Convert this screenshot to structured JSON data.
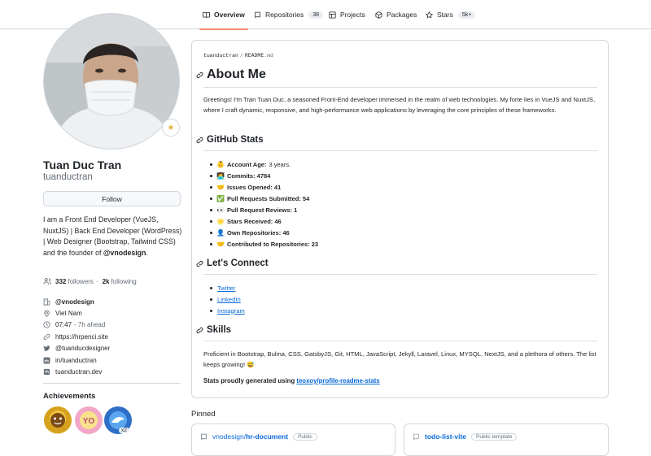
{
  "nav": {
    "tabs": [
      {
        "label": "Overview",
        "icon": "book-icon",
        "active": true
      },
      {
        "label": "Repositories",
        "icon": "repo-icon",
        "count": "38"
      },
      {
        "label": "Projects",
        "icon": "table-icon"
      },
      {
        "label": "Packages",
        "icon": "package-icon"
      },
      {
        "label": "Stars",
        "icon": "star-icon",
        "count": "5k+"
      }
    ]
  },
  "profile": {
    "full_name": "Tuan Duc Tran",
    "login": "tuanductran",
    "follow_label": "Follow",
    "bio_text": "I am a Front End Developer (VueJS, NuxtJS) | Back End Developer (WordPress) | Web Designer (Bootstrap, Tailwind CSS) and the founder of ",
    "bio_org": "@vnodesign",
    "bio_end": ".",
    "followers": "332",
    "followers_label": "followers",
    "sep": "·",
    "following": "2k",
    "following_label": "following",
    "org": "@vnodesign",
    "location": "Viet Nam",
    "time": "07:47",
    "time_offset": "- 7h ahead",
    "website": "https://hrpenci.site",
    "twitter": "@tuanducdesigner",
    "linkedin": "in/tuanductran",
    "mastodon": "tuanductran.dev"
  },
  "achievements": {
    "title": "Achievements",
    "multiplier": "x2"
  },
  "readme": {
    "path_user": "tuanductran",
    "path_sep": "/",
    "path_file": "README",
    "path_ext": ".md",
    "h_about": "About Me",
    "about_text": "Greetings! I'm Tran Tuan Duc, a seasoned Front-End developer immersed in the realm of web technologies. My forte lies in VueJS and NuxtJS, where I craft dynamic, responsive, and high-performance web applications by leveraging the core principles of these frameworks.",
    "h_stats": "GitHub Stats",
    "stats": [
      {
        "emoji": "👶",
        "label": "Account Age:",
        "value": "3 years."
      },
      {
        "emoji": "🧑‍💻",
        "label": "Commits: 4784",
        "value": ""
      },
      {
        "emoji": "🤝",
        "label": "Issues Opened: 41",
        "value": ""
      },
      {
        "emoji": "✅",
        "label": "Pull Requests Submitted: 54",
        "value": ""
      },
      {
        "emoji": "👀",
        "label": "Pull Request Reviews: 1",
        "value": ""
      },
      {
        "emoji": "🌟",
        "label": "Stars Received: 46",
        "value": ""
      },
      {
        "emoji": "👤",
        "label": "Own Repositories: 46",
        "value": ""
      },
      {
        "emoji": "🤝",
        "label": "Contributed to Repositories: 23",
        "value": ""
      }
    ],
    "h_connect": "Let's Connect",
    "connect_links": [
      "Twitter",
      "LinkedIn",
      "Instagram"
    ],
    "h_skills": "Skills",
    "skills_text": "Proficient in Bootstrap, Bulma, CSS, GatsbyJS, Git, HTML, JavaScript, Jekyll, Laravel, Linux, MYSQL, NextJS, and a plethora of others. The list keeps growing! 😅",
    "gen_text": "Stats proudly generated using ",
    "gen_link": "teoxoy/profile-readme-stats"
  },
  "pinned": {
    "title": "Pinned",
    "items": [
      {
        "owner": "vnodesign/",
        "name": "hr-document",
        "visibility": "Public"
      },
      {
        "owner": "",
        "name": "todo-list-vite",
        "visibility": "Public template"
      }
    ]
  },
  "colors": {
    "accent": "#fd8c73",
    "link": "#0969da",
    "muted": "#636c76",
    "border": "#d0d7de"
  }
}
